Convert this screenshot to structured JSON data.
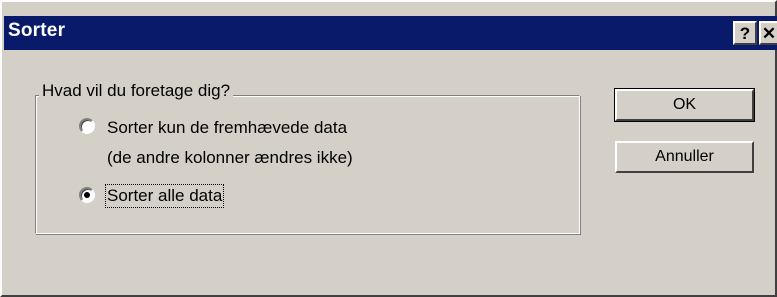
{
  "window": {
    "title": "Sorter",
    "help_label": "?",
    "close_label": "✕"
  },
  "group": {
    "label": "Hvad vil du foretage dig?",
    "options": [
      {
        "line1": "Sorter kun de fremhævede data",
        "line2": "(de andre kolonner ændres ikke)",
        "selected": false
      },
      {
        "line1": "Sorter alle data",
        "selected": true
      }
    ]
  },
  "buttons": {
    "ok": "OK",
    "cancel": "Annuller"
  },
  "colors": {
    "titlebar": "#0a1a6a",
    "face": "#d4d0c8"
  }
}
